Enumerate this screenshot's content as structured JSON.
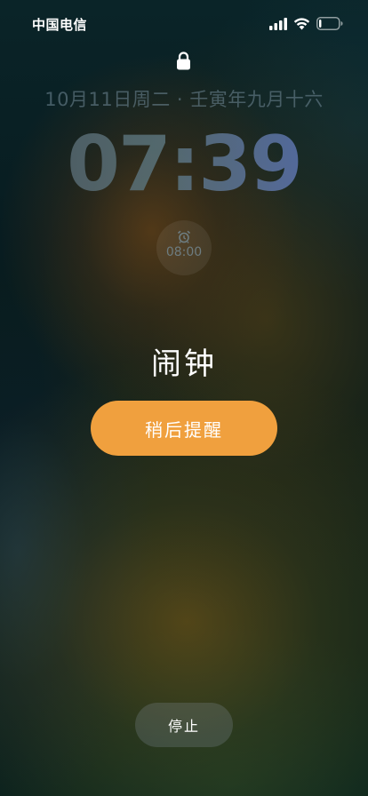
{
  "status_bar": {
    "carrier": "中国电信",
    "signal_icon": "signal-bars-icon",
    "wifi_icon": "wifi-icon",
    "battery_icon": "battery-icon",
    "battery_level": 0.12
  },
  "lock_screen": {
    "lock_icon": "lock-icon",
    "date": "10月11日周二 · 壬寅年九月十六",
    "time": "07:39"
  },
  "alarm_widget": {
    "icon": "alarm-clock-icon",
    "time": "08:00"
  },
  "alarm": {
    "title": "闹钟",
    "snooze_label": "稍后提醒",
    "stop_label": "停止"
  },
  "colors": {
    "snooze_button": "#f0a03e",
    "text": "#ffffff"
  }
}
